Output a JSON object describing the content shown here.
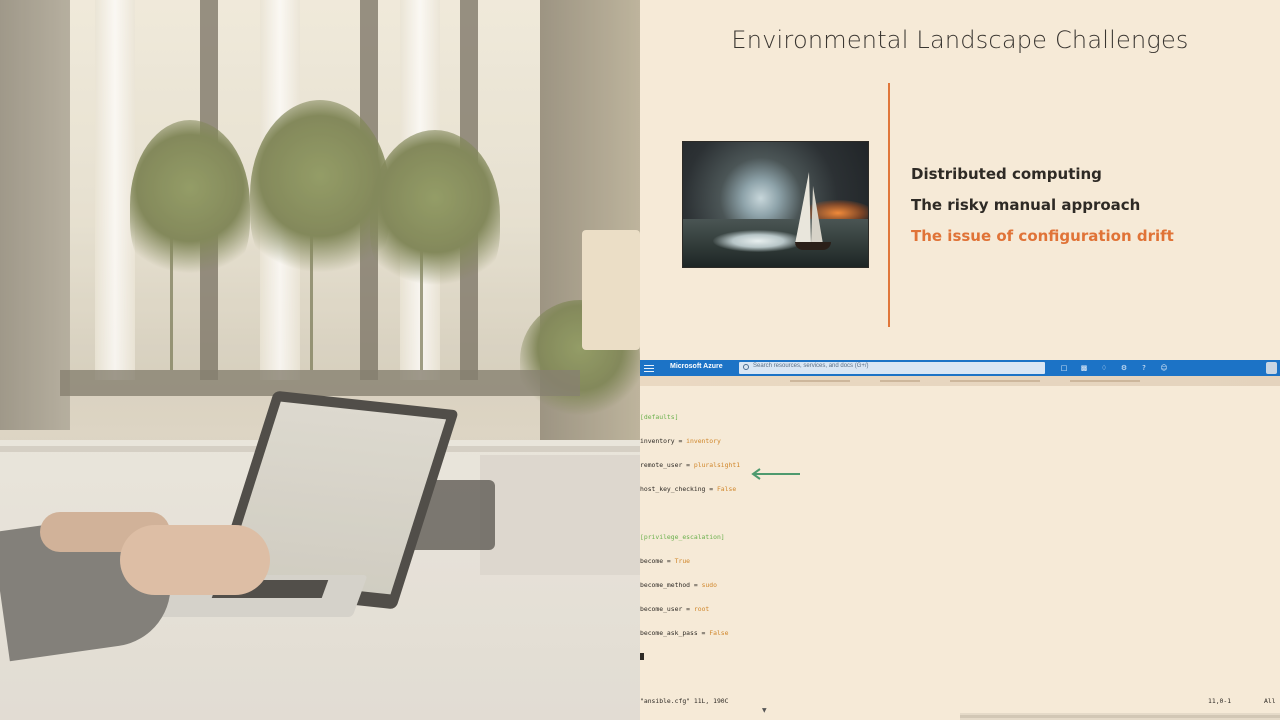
{
  "slide": {
    "title": "Environmental Landscape Challenges",
    "bullets": [
      "Distributed computing",
      "The risky manual approach",
      "The issue of configuration drift"
    ],
    "active_bullet_color": "#e07337",
    "accent_color": "#e0773a"
  },
  "azure": {
    "brand": "Microsoft Azure",
    "search_placeholder": "Search resources, services, and docs (G+/)",
    "bar_color": "#1c73c6",
    "icons": [
      "cloud-shell-icon",
      "directory-filter-icon",
      "notifications-icon",
      "settings-icon",
      "help-icon",
      "feedback-icon"
    ]
  },
  "editor": {
    "sec_defaults": "[defaults]",
    "inventory_key": "inventory = ",
    "inventory_val": "inventory",
    "remote_user_key": "remote_user = ",
    "remote_user_val": "pluralsight1",
    "host_key_key": "host_key_checking = ",
    "host_key_val": "False",
    "sec_privilege": "[privilege_escalation]",
    "become_key": "become = ",
    "become_val": "True",
    "become_method_key": "become_method = ",
    "become_method_val": "sudo",
    "become_user_key": "become_user = ",
    "become_user_val": "root",
    "become_ask_pass_key": "become_ask_pass = ",
    "become_ask_pass_val": "False",
    "status_file": "\"ansible.cfg\" 11L, 190C",
    "status_pos": "11,0-1",
    "status_scroll": "All",
    "arrow_color": "#4e9a6e"
  }
}
